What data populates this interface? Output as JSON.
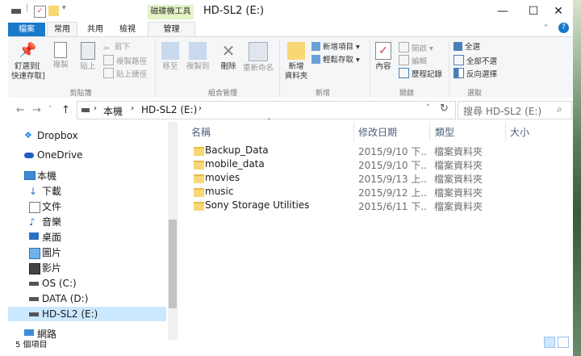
{
  "window": {
    "title": "HD-SL2 (E:)",
    "context_tab_group": "磁碟機工具",
    "minimize": "—",
    "maximize": "☐",
    "close": "✕"
  },
  "ribbon_tabs": [
    "檔案",
    "常用",
    "共用",
    "檢視",
    "管理"
  ],
  "ribbon": {
    "clipboard": {
      "label": "剪貼簿",
      "pin": "釘選到[\n快速存取]",
      "copy": "複製",
      "paste": "貼上",
      "cut": "剪下",
      "copy_path": "複製路徑",
      "paste_shortcut": "貼上捷徑"
    },
    "organize": {
      "label": "組合管理",
      "move_to": "移至",
      "copy_to": "複製到",
      "delete": "刪除",
      "rename": "重新命名"
    },
    "new": {
      "label": "新增",
      "new_folder": "新增\n資料夾",
      "new_item": "新增項目 ▾",
      "easy_access": "輕鬆存取 ▾"
    },
    "open": {
      "label": "開啟",
      "properties": "內容",
      "open": "開啟 ▾",
      "edit": "編輯",
      "history": "歷程記錄"
    },
    "select": {
      "label": "選取",
      "select_all": "全選",
      "select_none": "全部不選",
      "invert": "反向選擇"
    }
  },
  "address": {
    "segments": [
      "本機",
      "HD-SL2 (E:)"
    ],
    "search_placeholder": "搜尋 HD-SL2 (E:)"
  },
  "columns": {
    "name": "名稱",
    "date": "修改日期",
    "type": "類型",
    "size": "大小"
  },
  "nav": [
    {
      "label": "Dropbox",
      "icon": "dropbox-icon",
      "indent": 0
    },
    {
      "label": "OneDrive",
      "icon": "onedrive-icon",
      "indent": 0
    },
    {
      "label": "本機",
      "icon": "computer-icon",
      "indent": 0
    },
    {
      "label": "下載",
      "icon": "download-icon",
      "indent": 1
    },
    {
      "label": "文件",
      "icon": "documents-icon",
      "indent": 1
    },
    {
      "label": "音樂",
      "icon": "music-icon",
      "indent": 1
    },
    {
      "label": "桌面",
      "icon": "desktop-icon",
      "indent": 1
    },
    {
      "label": "圖片",
      "icon": "pictures-icon",
      "indent": 1
    },
    {
      "label": "影片",
      "icon": "videos-icon",
      "indent": 1
    },
    {
      "label": "OS (C:)",
      "icon": "drive-icon",
      "indent": 1
    },
    {
      "label": "DATA (D:)",
      "icon": "drive-icon",
      "indent": 1
    },
    {
      "label": "HD-SL2 (E:)",
      "icon": "drive-icon",
      "indent": 1,
      "selected": true
    },
    {
      "label": "網路",
      "icon": "network-icon",
      "indent": 0
    }
  ],
  "files": [
    {
      "name": "Backup_Data",
      "date": "2015/9/10 下...",
      "type": "檔案資料夾"
    },
    {
      "name": "mobile_data",
      "date": "2015/9/10 下...",
      "type": "檔案資料夾"
    },
    {
      "name": "movies",
      "date": "2015/9/13 上...",
      "type": "檔案資料夾"
    },
    {
      "name": "music",
      "date": "2015/9/12 上...",
      "type": "檔案資料夾"
    },
    {
      "name": "Sony Storage Utilities",
      "date": "2015/6/11 下...",
      "type": "檔案資料夾"
    }
  ],
  "status": {
    "count": "5 個項目"
  },
  "colors": {
    "accent": "#1979ca",
    "selected_nav": "#cce8ff",
    "folder": "#f8d775"
  }
}
